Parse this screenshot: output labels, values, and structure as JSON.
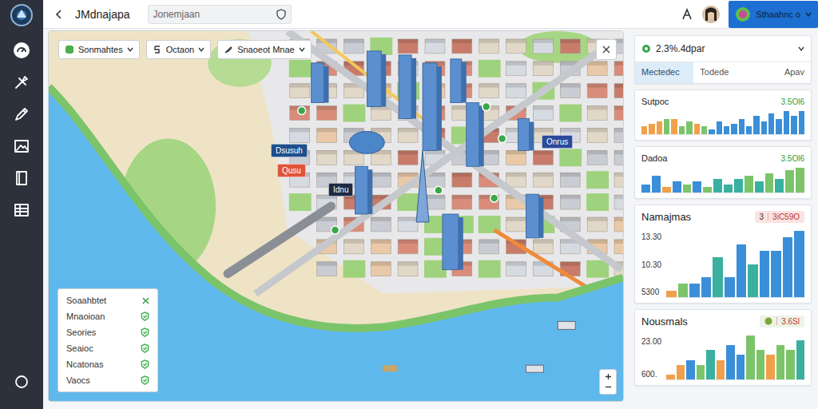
{
  "window": {
    "title": "JMdnajapa"
  },
  "topbar": {
    "search": {
      "value": "Jonemjaan"
    },
    "account": {
      "label": "Sthaahnc o"
    }
  },
  "map": {
    "filters": [
      {
        "label": "Sonmahtes"
      },
      {
        "label": "Octaon"
      },
      {
        "label": "Snaoeot Mnae"
      }
    ],
    "pins": [
      {
        "label": "Dsusuh",
        "color": "#1f4e8c"
      },
      {
        "label": "Qusu",
        "color": "#e0553a"
      },
      {
        "label": "Idnu",
        "color": "#1c2a44"
      },
      {
        "label": "Onrus",
        "color": "#2a4a9a"
      }
    ],
    "legend": {
      "title": "Soaahbtet",
      "items": [
        {
          "label": "Mnaoioan",
          "checked": true
        },
        {
          "label": "Seories",
          "checked": true
        },
        {
          "label": "Seaioc",
          "checked": true
        },
        {
          "label": "Ncatonas",
          "checked": true
        },
        {
          "label": "Vaocs",
          "checked": true
        }
      ]
    }
  },
  "panel": {
    "title": "2.3%.4dpar",
    "tabs": [
      {
        "label": "Mectedec",
        "selected": true
      },
      {
        "label": "Todede",
        "selected": false
      },
      {
        "label": "Apav",
        "selected": false
      }
    ]
  },
  "charts": [
    {
      "kind": "plain",
      "title": "Sutpoc",
      "value": "3.5Ol6",
      "ticks": [],
      "bars": [
        {
          "value": 3,
          "color": "#f0a04b"
        },
        {
          "value": 4,
          "color": "#f0a04b"
        },
        {
          "value": 5,
          "color": "#f0a04b"
        },
        {
          "value": 6,
          "color": "#7cc46a"
        },
        {
          "value": 6,
          "color": "#f0a04b"
        },
        {
          "value": 3,
          "color": "#7cc46a"
        },
        {
          "value": 5,
          "color": "#7cc46a"
        },
        {
          "value": 4,
          "color": "#f0a04b"
        },
        {
          "value": 3,
          "color": "#7cc46a"
        },
        {
          "value": 2,
          "color": "#3a8fd8"
        },
        {
          "value": 5,
          "color": "#3a8fd8"
        },
        {
          "value": 3,
          "color": "#3a8fd8"
        },
        {
          "value": 4,
          "color": "#3a8fd8"
        },
        {
          "value": 6,
          "color": "#3a8fd8"
        },
        {
          "value": 3,
          "color": "#3a8fd8"
        },
        {
          "value": 7,
          "color": "#3a8fd8"
        },
        {
          "value": 5,
          "color": "#3a8fd8"
        },
        {
          "value": 8,
          "color": "#3a8fd8"
        },
        {
          "value": 6,
          "color": "#3a8fd8"
        },
        {
          "value": 9,
          "color": "#3a8fd8"
        },
        {
          "value": 7,
          "color": "#3a8fd8"
        },
        {
          "value": 9,
          "color": "#3a8fd8"
        }
      ]
    },
    {
      "kind": "plain",
      "title": "Dadoa",
      "value": "3.5Ol6",
      "ticks": [],
      "bars": [
        {
          "value": 3,
          "color": "#3a8fd8"
        },
        {
          "value": 6,
          "color": "#3a8fd8"
        },
        {
          "value": 2,
          "color": "#f0a04b"
        },
        {
          "value": 4,
          "color": "#3a8fd8"
        },
        {
          "value": 3,
          "color": "#7cc46a"
        },
        {
          "value": 4,
          "color": "#3a8fd8"
        },
        {
          "value": 2,
          "color": "#7cc46a"
        },
        {
          "value": 5,
          "color": "#3ab0a0"
        },
        {
          "value": 3,
          "color": "#3ab0a0"
        },
        {
          "value": 5,
          "color": "#3ab0a0"
        },
        {
          "value": 6,
          "color": "#7cc46a"
        },
        {
          "value": 4,
          "color": "#3ab0a0"
        },
        {
          "value": 7,
          "color": "#7cc46a"
        },
        {
          "value": 5,
          "color": "#3ab0a0"
        },
        {
          "value": 8,
          "color": "#7cc46a"
        },
        {
          "value": 9,
          "color": "#7cc46a"
        }
      ]
    },
    {
      "kind": "pill",
      "title": "Namajmas",
      "badge": "3",
      "value": "3iC59O",
      "ticks": [
        "13.30",
        "10.30",
        "5300"
      ],
      "bars": [
        {
          "value": 1,
          "color": "#f0a04b"
        },
        {
          "value": 2,
          "color": "#7cc46a"
        },
        {
          "value": 2,
          "color": "#3a8fd8"
        },
        {
          "value": 3,
          "color": "#3a8fd8"
        },
        {
          "value": 6,
          "color": "#3ab0a0"
        },
        {
          "value": 3,
          "color": "#3a8fd8"
        },
        {
          "value": 8,
          "color": "#3a8fd8"
        },
        {
          "value": 5,
          "color": "#3ab0a0"
        },
        {
          "value": 7,
          "color": "#3a8fd8"
        },
        {
          "value": 7,
          "color": "#3a8fd8"
        },
        {
          "value": 9,
          "color": "#3a8fd8"
        },
        {
          "value": 10,
          "color": "#3a8fd8"
        }
      ]
    },
    {
      "kind": "pill",
      "title": "Nousmals",
      "value": "3.6Sl",
      "ticks": [
        "23.00",
        "600."
      ],
      "bars": [
        {
          "value": 1,
          "color": "#f0a04b"
        },
        {
          "value": 3,
          "color": "#f0a04b"
        },
        {
          "value": 4,
          "color": "#3a8fd8"
        },
        {
          "value": 3,
          "color": "#7cc46a"
        },
        {
          "value": 6,
          "color": "#3ab0a0"
        },
        {
          "value": 4,
          "color": "#f0a04b"
        },
        {
          "value": 7,
          "color": "#3a8fd8"
        },
        {
          "value": 5,
          "color": "#3a8fd8"
        },
        {
          "value": 9,
          "color": "#7cc46a"
        },
        {
          "value": 6,
          "color": "#7cc46a"
        },
        {
          "value": 5,
          "color": "#f0a04b"
        },
        {
          "value": 7,
          "color": "#7cc46a"
        },
        {
          "value": 6,
          "color": "#7cc46a"
        },
        {
          "value": 8,
          "color": "#3ab0a0"
        }
      ]
    }
  ]
}
